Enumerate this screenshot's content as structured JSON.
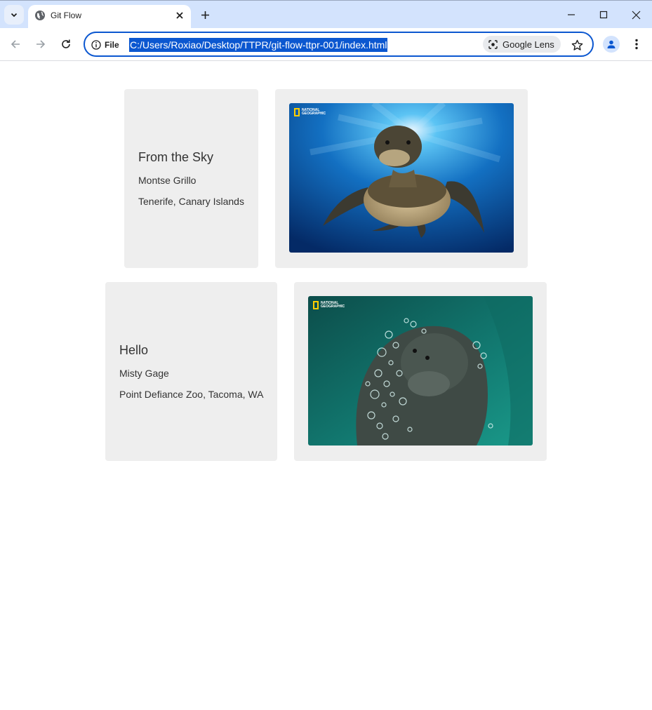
{
  "browser": {
    "tab_title": "Git Flow",
    "site_info_label": "File",
    "url": "C:/Users/Roxiao/Desktop/TTPR/git-flow-ttpr-001/index.html",
    "lens_label": "Google Lens",
    "accent_color": "#0b57d0"
  },
  "page": {
    "cards": [
      {
        "title": "From the Sky",
        "author": "Montse Grillo",
        "location": "Tenerife, Canary Islands",
        "image": {
          "subject": "sea turtle swimming underwater",
          "watermark": "NATIONAL GEOGRAPHIC"
        }
      },
      {
        "title": "Hello",
        "author": "Misty Gage",
        "location": "Point Defiance Zoo, Tacoma, WA",
        "image": {
          "subject": "walrus underwater with bubbles",
          "watermark": "NATIONAL GEOGRAPHIC"
        }
      }
    ]
  }
}
